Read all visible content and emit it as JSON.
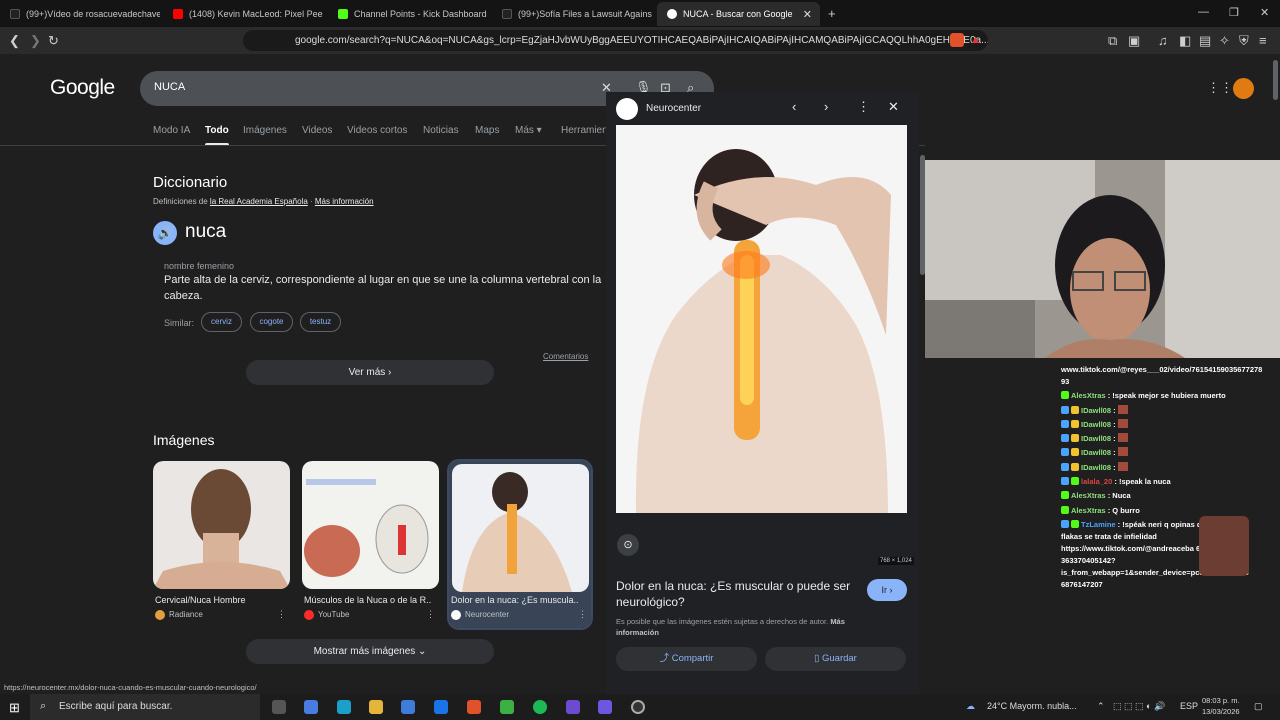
{
  "browser": {
    "tabs": [
      {
        "label": "(99+)Vídeo de rosacuevadechaves (@",
        "color": "#111111"
      },
      {
        "label": "(1408) Kevin MacLeod: Pixel Peek",
        "color": "#ff0000"
      },
      {
        "label": "Channel Points - Kick Dashboard",
        "color": "#53fc18"
      },
      {
        "label": "(99+)Sofía Files a Lawsuit Against Ad",
        "color": "#111111"
      },
      {
        "label": "NUCA - Buscar con Google",
        "color": "#ffffff"
      }
    ],
    "url": "google.com/search?q=NUCA&oq=NUCA&gs_lcrp=EgZjaHJvbWUyBggAEEUYOTIHCAEQABiPAjIHCAIQABiPAjIHCAMQABiPAjIGCAQQLhhA0gEHMzE0a..."
  },
  "google": {
    "logo": "Google",
    "query": "NUCA",
    "tabs": [
      "Modo IA",
      "Todo",
      "Imágenes",
      "Videos",
      "Videos cortos",
      "Noticias",
      "Maps",
      "Más ▾",
      "Herramientas ▾"
    ],
    "active_tab": "Todo"
  },
  "dictionary": {
    "title": "Diccionario",
    "source_prefix": "Definiciones de ",
    "source_link": "la Real Academia Española",
    "more_info": "Más información",
    "word": "nuca",
    "pos": "nombre femenino",
    "definition": "Parte alta de la cerviz, correspondiente al lugar en que se une la columna vertebral con la cabeza.",
    "similar_label": "Similar:",
    "similar": [
      "cerviz",
      "cogote",
      "testuz"
    ],
    "comments": "Comentarios",
    "see_more": "Ver más  ›"
  },
  "images": {
    "title": "Imágenes",
    "cards": [
      {
        "title": "Cervical/Nuca Hombre",
        "source": "Radiance",
        "dot": "#e0a040"
      },
      {
        "title": "Músculos de la Nuca o de la R...",
        "source": "YouTube",
        "dot": "#ff2b2b"
      },
      {
        "title": "Dolor en la nuca: ¿Es muscula...",
        "source": "Neurocenter",
        "dot": "#ffffff"
      }
    ],
    "show_more": "Mostrar más imágenes  ⌄"
  },
  "panel": {
    "brand": "Neurocenter",
    "dimensions": "768 × 1,024",
    "title": "Dolor en la nuca: ¿Es muscular o puede ser neurológico?",
    "go": "Ir  ›",
    "note_prefix": "Es posible que las imágenes estén sujetas a derechos de autor. ",
    "note_link": "Más información",
    "share": "Compartir",
    "save": "Guardar"
  },
  "status_url": "https://neurocenter.mx/dolor-nuca-cuando-es-muscular-cuando-neurologico/",
  "chat": {
    "lines": [
      {
        "user": "",
        "text": "www.tiktok.com/@reyes___02/video/76154159035677278"
      },
      {
        "user": "",
        "text": "93"
      },
      {
        "user": "AlesXtras",
        "text": " : !speak mejor se hubiera muerto"
      },
      {
        "user": "IDawll08",
        "text": " : "
      },
      {
        "user": "IDawll08",
        "text": " : "
      },
      {
        "user": "IDawll08",
        "text": " : "
      },
      {
        "user": "IDawll08",
        "text": " : "
      },
      {
        "user": "IDawll08",
        "text": " : "
      },
      {
        "user": "lalala_20",
        "text": " : !speak la nuca"
      },
      {
        "user": "AlesXtras",
        "text": " : Nuca"
      },
      {
        "user": "AlesXtras",
        "text": " : Q burro"
      },
      {
        "user": "TzLamine",
        "text": " : !spéak neri q opinas de las"
      },
      {
        "user": "",
        "text": "flakas se trata de infielidad"
      },
      {
        "user": "",
        "text": "https://www.tiktok.com/@andreaceba 616111"
      },
      {
        "user": "",
        "text": "363370405142?"
      },
      {
        "user": "",
        "text": "is_from_webapp=1&sender_device=pc&v 758969766"
      },
      {
        "user": "",
        "text": "6876147207"
      }
    ]
  },
  "taskbar": {
    "search_placeholder": "Escribe aquí para buscar.",
    "weather": "24°C  Mayorm. nubla...",
    "lang": "ESP",
    "time": "08:03 p. m.",
    "date": "13/03/2026"
  }
}
